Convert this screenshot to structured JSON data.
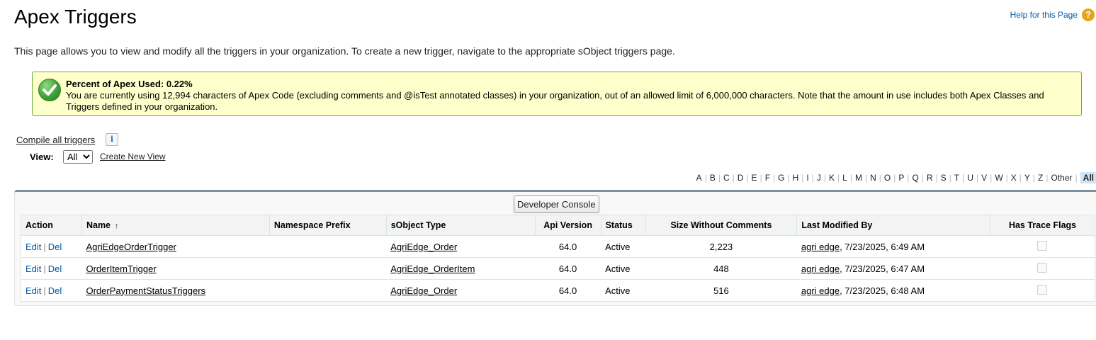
{
  "page": {
    "title": "Apex Triggers",
    "help_link": "Help for this Page",
    "help_icon_glyph": "?",
    "description": "This page allows you to view and modify all the triggers in your organization. To create a new trigger, navigate to the appropriate sObject triggers page."
  },
  "info_box": {
    "title": "Percent of Apex Used: 0.22%",
    "text": "You are currently using 12,994 characters of Apex Code (excluding comments and @isTest annotated classes) in your organization, out of an allowed limit of 6,000,000 characters. Note that the amount in use includes both Apex Classes and Triggers defined in your organization.",
    "icon": "success-check-icon"
  },
  "controls": {
    "compile_link": "Compile all triggers",
    "info_glyph": "i",
    "view_label": "View:",
    "view_selected": "All",
    "create_view_link": "Create New View",
    "developer_console": "Developer Console"
  },
  "alphabet": {
    "letters": [
      "A",
      "B",
      "C",
      "D",
      "E",
      "F",
      "G",
      "H",
      "I",
      "J",
      "K",
      "L",
      "M",
      "N",
      "O",
      "P",
      "Q",
      "R",
      "S",
      "T",
      "U",
      "V",
      "W",
      "X",
      "Y",
      "Z",
      "Other",
      "All"
    ],
    "active": "All"
  },
  "table": {
    "headers": {
      "action": "Action",
      "name": "Name",
      "sort_glyph": "↑",
      "namespace": "Namespace Prefix",
      "sobject": "sObject Type",
      "api": "Api Version",
      "status": "Status",
      "size": "Size Without Comments",
      "modified": "Last Modified By",
      "trace": "Has Trace Flags"
    },
    "edit_label": "Edit",
    "del_label": "Del",
    "separator": "|",
    "rows": [
      {
        "name": "AgriEdgeOrderTrigger",
        "namespace": "",
        "sobject": "AgriEdge_Order",
        "api": "64.0",
        "status": "Active",
        "size": "2,223",
        "modified_user": "agri edge",
        "modified_date": ", 7/23/2025, 6:49 AM",
        "trace": false
      },
      {
        "name": "OrderItemTrigger",
        "namespace": "",
        "sobject": "AgriEdge_OrderItem",
        "api": "64.0",
        "status": "Active",
        "size": "448",
        "modified_user": "agri edge",
        "modified_date": ", 7/23/2025, 6:47 AM",
        "trace": false
      },
      {
        "name": "OrderPaymentStatusTriggers",
        "namespace": "",
        "sobject": "AgriEdge_Order",
        "api": "64.0",
        "status": "Active",
        "size": "516",
        "modified_user": "agri edge",
        "modified_date": ", 7/23/2025, 6:48 AM",
        "trace": false
      }
    ]
  },
  "colors": {
    "link_blue": "#015ba7",
    "info_border": "#6ca942",
    "info_bg": "#ffffcc",
    "panel_top_border": "#7b8fa4",
    "alpha_active_bg": "#cfe4f5"
  }
}
